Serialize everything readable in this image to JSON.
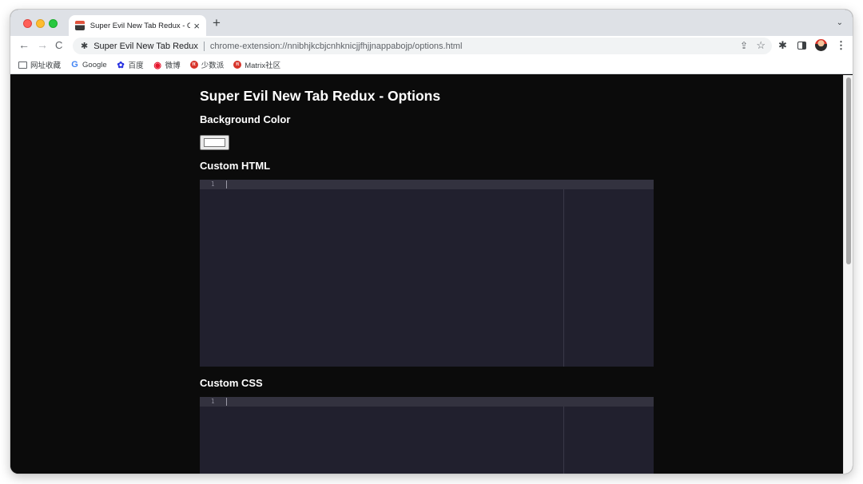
{
  "browser": {
    "tab": {
      "title": "Super Evil New Tab Redux - Options",
      "close_icon": "×"
    },
    "new_tab_icon": "+",
    "tab_menu_icon": "⌄",
    "nav": {
      "back_icon": "←",
      "forward_icon": "→",
      "reload_icon": "C"
    },
    "omnibox": {
      "site_name": "Super Evil New Tab Redux",
      "url": "chrome-extension://nnibhjkcbjcnhknicjjfhjjnappabojp/options.html"
    },
    "bookmarks": [
      {
        "label": "网址收藏",
        "icon": "folder-icon"
      },
      {
        "label": "Google",
        "icon": "google-icon",
        "glyph": "G"
      },
      {
        "label": "百度",
        "icon": "baidu-icon",
        "glyph": "✿"
      },
      {
        "label": "微博",
        "icon": "weibo-icon",
        "glyph": "◉"
      },
      {
        "label": "少数派",
        "icon": "sspai-icon",
        "glyph": "π"
      },
      {
        "label": "Matrix社区",
        "icon": "matrix-icon",
        "glyph": "π"
      }
    ]
  },
  "page": {
    "title": "Super Evil New Tab Redux - Options",
    "background_color_label": "Background Color",
    "background_color_value": "#ffffff",
    "custom_html_label": "Custom HTML",
    "custom_css_label": "Custom CSS",
    "editor_html": {
      "line_number": "1",
      "content": ""
    },
    "editor_css": {
      "line_number": "1",
      "content": ""
    }
  },
  "colors": {
    "page_background": "#0b0b0b",
    "editor_background": "#21202e",
    "editor_active_line": "#33323f"
  }
}
